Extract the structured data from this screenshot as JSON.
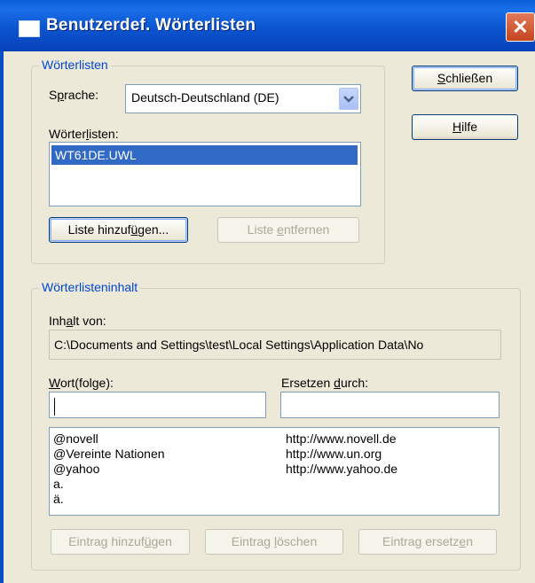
{
  "window": {
    "title": "Benutzerdef. Wörterlisten",
    "close_symbol": "✕"
  },
  "group_lists": {
    "legend": "Wörterlisten",
    "language_label_pre": "S",
    "language_label_u": "p",
    "language_label_post": "rache:",
    "language_value": "Deutsch-Deutschland (DE)",
    "lists_label_pre": "Wörter",
    "lists_label_u": "l",
    "lists_label_post": "isten:",
    "lists": [
      "WT61DE.UWL"
    ],
    "add_list_pre": "Liste hinzuf",
    "add_list_u": "ü",
    "add_list_post": "gen...",
    "remove_list_pre": "Liste ",
    "remove_list_u": "e",
    "remove_list_post": "ntfernen"
  },
  "buttons": {
    "close_u": "S",
    "close_post": "chließen",
    "help_u": "H",
    "help_post": "ilfe"
  },
  "group_content": {
    "legend": "Wörterlisteninhalt",
    "content_of_pre": "Inh",
    "content_of_u": "a",
    "content_of_post": "lt von:",
    "path": "C:\\Documents and Settings\\test\\Local Settings\\Application Data\\No",
    "word_label_u": "W",
    "word_label_post": "ort(folge):",
    "word_value": "",
    "replace_label_pre": "Ersetzen ",
    "replace_label_u": "d",
    "replace_label_post": "urch:",
    "replace_value": "",
    "entries": [
      {
        "word": "@novell",
        "replacement": "http://www.novell.de"
      },
      {
        "word": "@Vereinte Nationen",
        "replacement": "http://www.un.org"
      },
      {
        "word": "@yahoo",
        "replacement": "http://www.yahoo.de"
      },
      {
        "word": "a.",
        "replacement": ""
      },
      {
        "word": "ä.",
        "replacement": ""
      }
    ],
    "add_entry_pre": "Eintrag hinzuf",
    "add_entry_u": "ü",
    "add_entry_post": "gen",
    "delete_entry_pre": "Eintrag ",
    "delete_entry_u": "l",
    "delete_entry_post": "öschen",
    "replace_entry_pre": "Eintrag ersetz",
    "replace_entry_u": "e",
    "replace_entry_post": "n"
  },
  "colors": {
    "titlebar": "#0b55d0",
    "selection": "#316ac5",
    "group_legend": "#0046d5",
    "dialog_bg": "#ece9d8"
  }
}
